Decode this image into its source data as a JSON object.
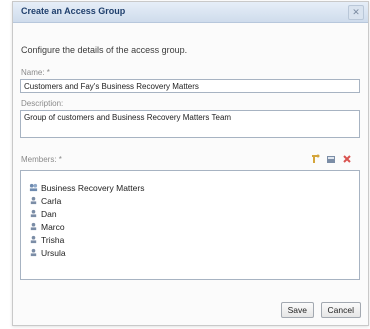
{
  "dialog": {
    "title": "Create an Access Group",
    "close_icon": "close-icon",
    "hint": "Configure the details of the access group.",
    "name_label": "Name: *",
    "name_value": "Customers and Fay's Business Recovery Matters",
    "description_label": "Description:",
    "description_value": "Group of customers and Business Recovery Matters Team",
    "members_label": "Members: *",
    "toolbar_icons": [
      "add-member-icon",
      "edit-member-icon",
      "remove-member-icon"
    ],
    "members": [
      {
        "label": "Business Recovery Matters",
        "icon": "group-icon"
      },
      {
        "label": "Carla",
        "icon": "user-icon"
      },
      {
        "label": "Dan",
        "icon": "user-icon"
      },
      {
        "label": "Marco",
        "icon": "user-icon"
      },
      {
        "label": "Trisha",
        "icon": "user-icon"
      },
      {
        "label": "Ursula",
        "icon": "user-icon"
      }
    ],
    "save_label": "Save",
    "cancel_label": "Cancel"
  }
}
